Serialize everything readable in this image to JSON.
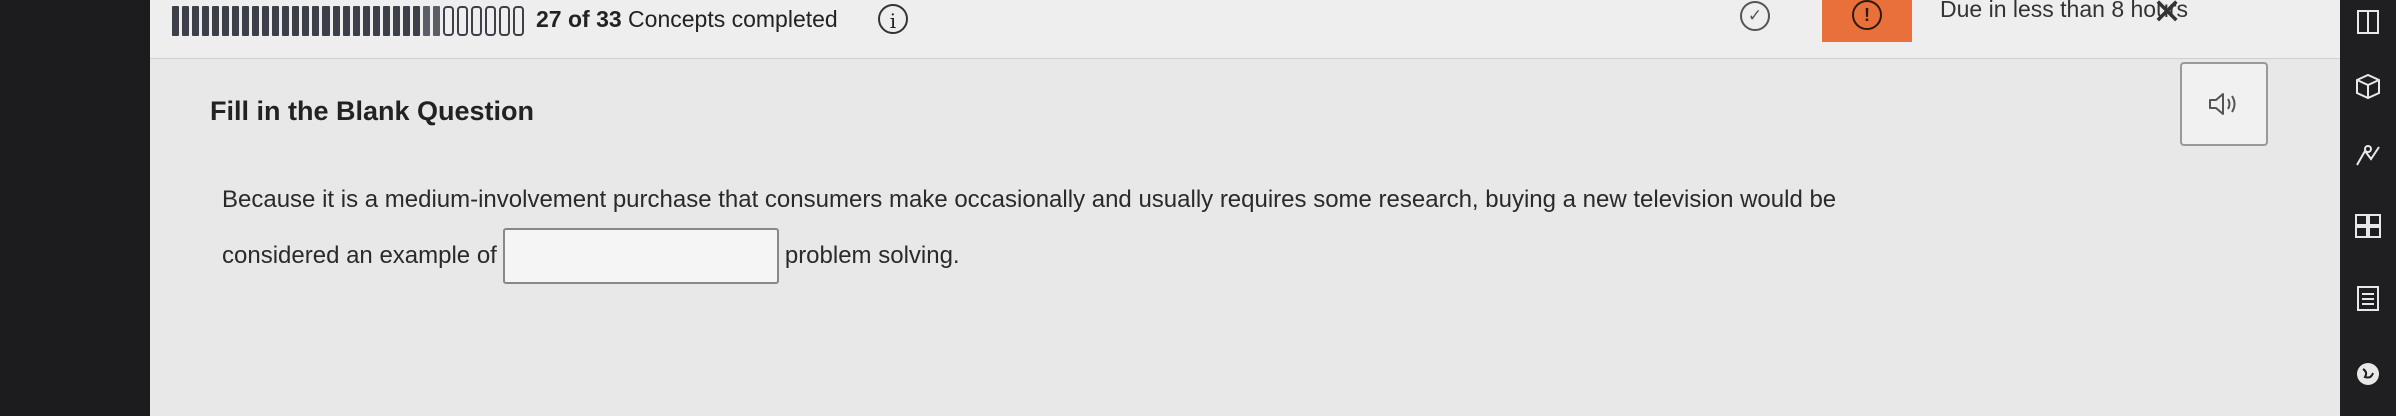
{
  "progress": {
    "completed": 27,
    "total": 33,
    "label_count": "27 of 33",
    "label_suffix": "Concepts completed"
  },
  "header": {
    "info_icon": "info-icon",
    "check_icon": "check-circle-icon",
    "alert_icon": "alert-icon",
    "alert_color": "#e9703a",
    "due_text": "Due in less than 8 hours",
    "close_icon": "close-icon"
  },
  "question": {
    "title": "Fill in the Blank Question",
    "text_part1": "Because it is a medium-involvement purchase that consumers make occasionally and usually requires some research, buying a new television would be",
    "text_part2": "considered an example of",
    "blank_value": "",
    "text_part3": "problem solving.",
    "audio_icon": "speaker-icon"
  },
  "right_rail": {
    "icons": [
      "book-icon",
      "box-icon",
      "hands-icon",
      "flashcards-icon",
      "notes-icon",
      "globe-icon"
    ]
  }
}
